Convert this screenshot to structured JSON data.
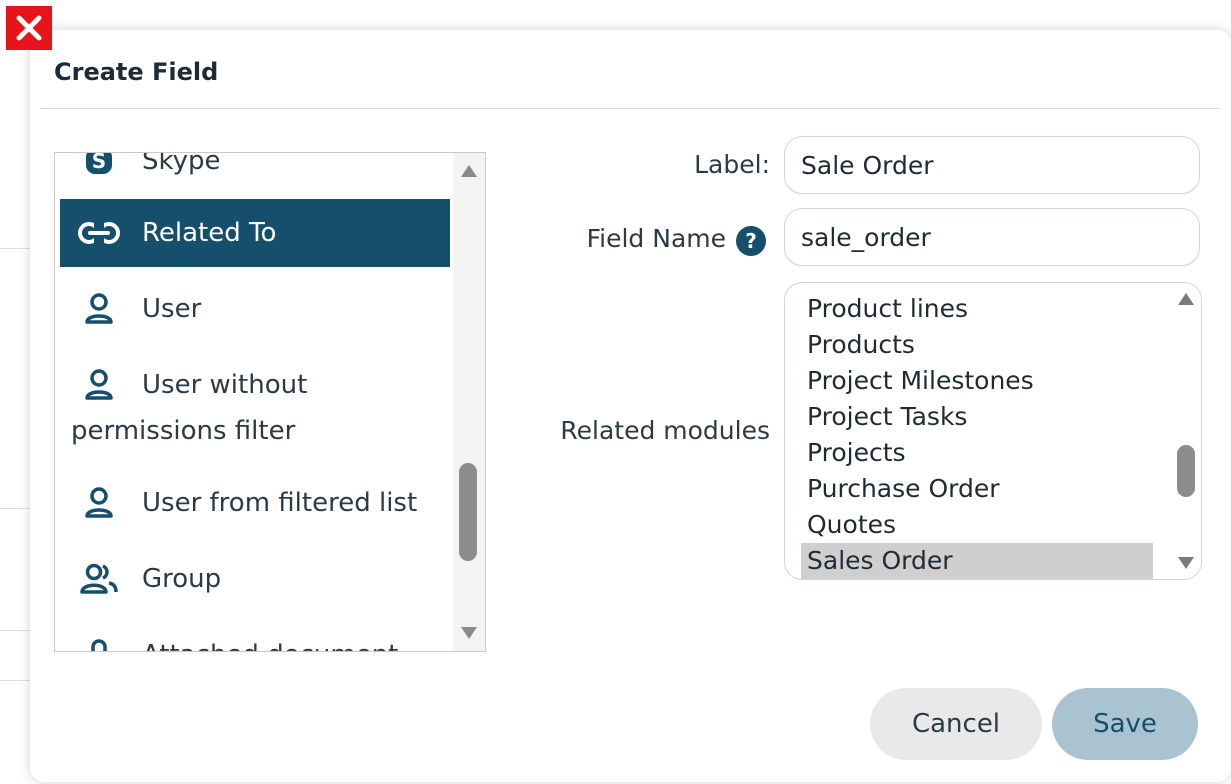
{
  "dialog": {
    "title": "Create Field"
  },
  "field_types": [
    {
      "label": "Skype",
      "icon": "skype-icon"
    },
    {
      "label": "Related To",
      "icon": "link-icon",
      "selected": true
    },
    {
      "label": "User",
      "icon": "user-icon"
    },
    {
      "label": "User without",
      "label_line2": "permissions filter",
      "icon": "user-icon"
    },
    {
      "label": "User from filtered list",
      "icon": "user-icon"
    },
    {
      "label": "Group",
      "icon": "group-icon"
    },
    {
      "label": "Attached document",
      "icon": "attachment-icon"
    }
  ],
  "form": {
    "label_caption": "Label:",
    "label_value": "Sale Order",
    "field_name_caption": "Field Name",
    "field_name_value": "sale_order",
    "related_modules_caption": "Related modules",
    "related_modules": [
      "Product lines",
      "Products",
      "Project Milestones",
      "Project Tasks",
      "Projects",
      "Purchase Order",
      "Quotes",
      "Sales Order"
    ],
    "selected_module": "Sales Order"
  },
  "buttons": {
    "cancel": "Cancel",
    "save": "Save"
  },
  "colors": {
    "accent": "#154f6b",
    "close": "#e8141b",
    "save_bg": "#a9c4d0",
    "selected_module_bg": "#cfcfcf"
  }
}
